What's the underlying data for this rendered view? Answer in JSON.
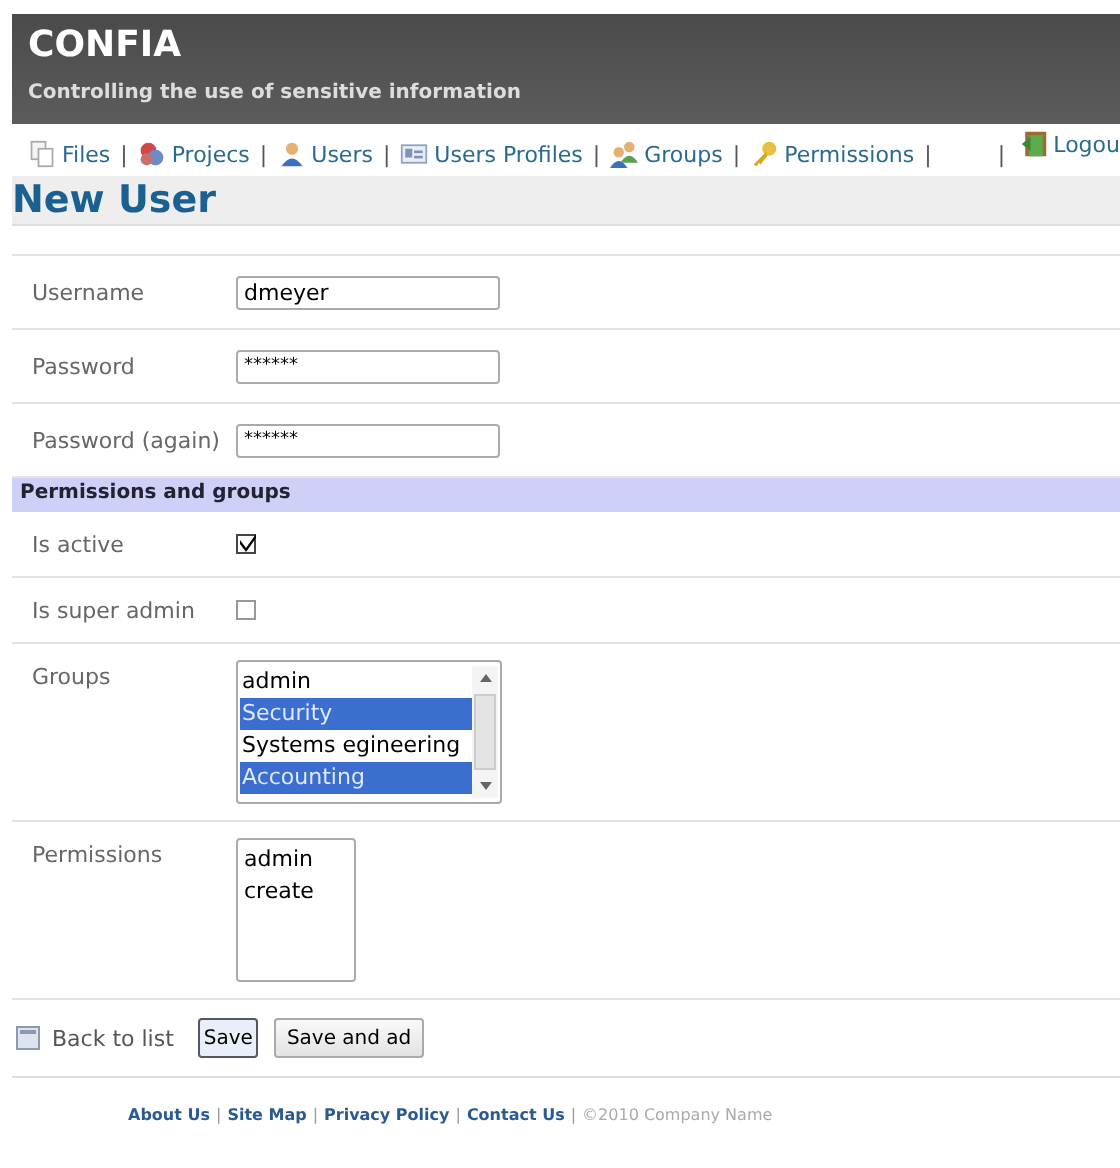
{
  "header": {
    "title": "CONFIA",
    "subtitle": "Controlling the use of sensitive information"
  },
  "nav": {
    "separator": "|",
    "items": [
      {
        "label": "Files"
      },
      {
        "label": "Projecs"
      },
      {
        "label": "Users"
      },
      {
        "label": "Users Profiles"
      },
      {
        "label": "Groups"
      },
      {
        "label": "Permissions"
      }
    ],
    "logout": "Logou"
  },
  "page_title": "New User",
  "fields": [
    {
      "label": "Username",
      "value": "dmeyer"
    },
    {
      "label": "Password",
      "value": "******"
    },
    {
      "label": "Password (again)",
      "value": "******"
    }
  ],
  "section": "Permissions and groups",
  "checkboxes": [
    {
      "label": "Is active",
      "checked": true
    },
    {
      "label": "Is super admin",
      "checked": false
    }
  ],
  "groups": {
    "label": "Groups",
    "options": [
      {
        "label": "admin",
        "selected": false
      },
      {
        "label": "Security",
        "selected": true
      },
      {
        "label": "Systems egineering",
        "selected": false
      },
      {
        "label": "Accounting",
        "selected": true
      }
    ]
  },
  "permissions": {
    "label": "Permissions",
    "options": [
      {
        "label": "admin",
        "selected": false
      },
      {
        "label": "create",
        "selected": false
      }
    ]
  },
  "actions": {
    "back": "Back to list",
    "buttons": [
      "Save",
      "Save and ad"
    ]
  },
  "footer": {
    "links": [
      "About Us",
      "Site Map",
      "Privacy Policy",
      "Contact Us"
    ],
    "copyright": "©2010 Company Name",
    "separator": "|"
  }
}
